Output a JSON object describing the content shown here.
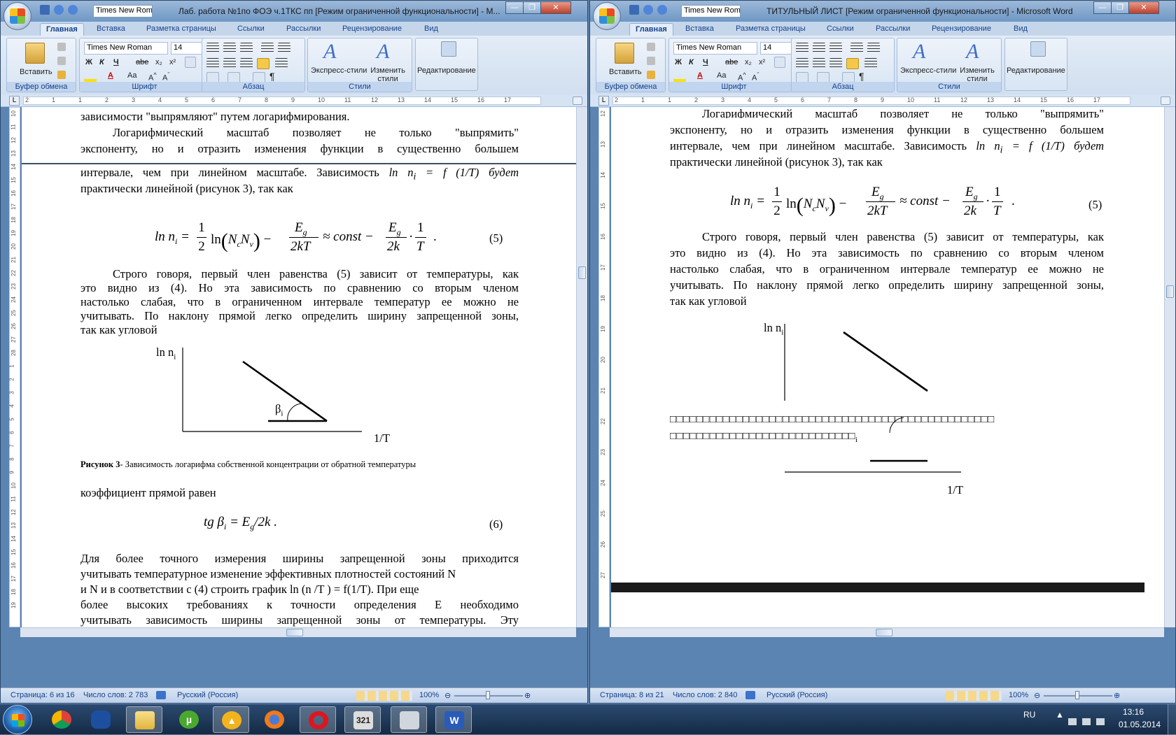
{
  "left": {
    "title": "Лаб. работа №1по ФОЭ ч.1ТКС пп [Режим ограниченной функциональности] - M...",
    "font_name": "Times New Roman",
    "font_size": "14",
    "tabs": [
      "Главная",
      "Вставка",
      "Разметка страницы",
      "Ссылки",
      "Рассылки",
      "Рецензирование",
      "Вид"
    ],
    "groups": {
      "clipboard": "Буфер обмена",
      "font": "Шрифт",
      "paragraph": "Абзац",
      "styles": "Стили"
    },
    "paste_label": "Вставить",
    "express_styles": "Экспресс-стили",
    "change_styles": "Изменить стили",
    "editing": "Редактирование",
    "ruler_numbers": [
      "2",
      "1",
      "1",
      "2",
      "3",
      "4",
      "5",
      "6",
      "7",
      "8",
      "9",
      "10",
      "11",
      "12",
      "13",
      "14",
      "15",
      "16",
      "17"
    ],
    "vruler_numbers": [
      "10",
      "11",
      "12",
      "13",
      "14",
      "15",
      "16",
      "17",
      "18",
      "19",
      "20",
      "21",
      "22",
      "23",
      "24",
      "25",
      "26",
      "27",
      "28",
      "1",
      "2",
      "3",
      "4",
      "5",
      "6",
      "7",
      "8",
      "9",
      "10",
      "11",
      "12",
      "13",
      "14",
      "15",
      "16",
      "17",
      "18",
      "19"
    ],
    "line_top1": "зависимости \"выпрямляют\" путем логарифмирования.",
    "line_top2": "Логарифмический масштаб позволяет не только \"выпрямить\"",
    "line_top3": "экспоненту, но и отразить изменения функции в существенно большем",
    "p1a": "интервале, чем при линейном масштабе. Зависимость",
    "p1a_math": "ln n",
    "p1a_sub": "i",
    "p1a_tail": " = f (1/T) будет",
    "p1b": "практически линейной (рисунок 3), так как",
    "f5_lhs": "ln n",
    "f5_sub": "i",
    "f5_half": "1",
    "f5_two": "2",
    "f5_ln": "ln",
    "f5_NcNv": "N",
    "f5_c": "c",
    "f5_Nv": "N",
    "f5_v": "v",
    "f5_E": "E",
    "f5_g": "g",
    "f5_2kT": "2kT",
    "f5_const": "≈ const −",
    "f5_2k": "2k",
    "f5_one": "1",
    "f5_T": "T",
    "f5_num": "(5)",
    "p2": [
      "Строго говоря, первый член равенства (5) зависит от температуры, как",
      "это видно из (4). Но эта зависимость по сравнению со вторым членом",
      "настолько слабая, что в ограниченном интервале температур ее можно не",
      "учитывать. По наклону прямой легко определить ширину запрещенной зоны,",
      "так как угловой"
    ],
    "fig_ylabel": "ln n",
    "fig_ysub": "i",
    "fig_beta": "β",
    "fig_betasub": "i",
    "fig_xlabel": "1/T",
    "caption_bold": "Рисунок 3",
    "caption_rest": "- Зависимость логарифма собственной концентрации от обратной температуры",
    "p3": "коэффициент прямой равен",
    "f6": "tg β",
    "f6_sub": "i",
    "f6_rest": "= E",
    "f6_g": "g",
    "f6_tail": "/2k .",
    "f6_num": "(6)",
    "p4": [
      "Для более точного измерения ширины запрещенной зоны приходится",
      "учитывать температурное изменение эффективных плотностей состояний N",
      "и N   и в соответствии с (4) строить график ln (n  /T    ) = f(1/T). При еще",
      "более высоких требованиях к точности определения E  необходимо",
      "учитывать зависимость ширины запрещенной зоны от температуры. Эту"
    ],
    "p4_sub_c": "c",
    "p4_sub_v": "v",
    "status_page": "Страница: 6 из 16",
    "status_words": "Число слов: 2 783",
    "status_lang": "Русский (Россия)",
    "zoom": "100%"
  },
  "right": {
    "title": "ТИТУЛЬНЫЙ ЛИСТ [Режим ограниченной функциональности] - Microsoft Word",
    "font_name": "Times New Roman",
    "font_size": "14",
    "tabs": [
      "Главная",
      "Вставка",
      "Разметка страницы",
      "Ссылки",
      "Рассылки",
      "Рецензирование",
      "Вид"
    ],
    "groups": {
      "clipboard": "Буфер обмена",
      "font": "Шрифт",
      "paragraph": "Абзац",
      "styles": "Стили"
    },
    "paste_label": "Вставить",
    "express_styles": "Экспресс-стили",
    "change_styles": "Изменить стили",
    "editing": "Редактирование",
    "ruler_numbers": [
      "2",
      "1",
      "1",
      "2",
      "3",
      "4",
      "5",
      "6",
      "7",
      "8",
      "9",
      "10",
      "11",
      "12",
      "13",
      "14",
      "15",
      "16",
      "17"
    ],
    "vruler_numbers": [
      "12",
      "13",
      "14",
      "15",
      "16",
      "17",
      "18",
      "19",
      "20",
      "21",
      "22",
      "23",
      "24",
      "25",
      "26",
      "27"
    ],
    "line_top1": "Логарифмический масштаб позволяет не только \"выпрямить\"",
    "p1": [
      "экспоненту, но и отразить изменения функции в существенно большем"
    ],
    "p1b_a": "интервале, чем при линейном масштабе. Зависимость",
    "p1b_math": "ln n",
    "p1b_sub": "i",
    "p1b_tail": " = f (1/T) будет",
    "p1c": "практически линейной (рисунок 3), так как",
    "f5_num": "(5)",
    "p2": [
      "Строго говоря, первый член равенства (5) зависит от температуры, как",
      "это видно из (4). Но эта зависимость по сравнению со вторым членом",
      "настолько слабая, что в ограниченном интервале температур ее можно не",
      "учитывать. По наклону прямой легко определить ширину запрещенной зоны,",
      "так как угловой"
    ],
    "fig_ylabel": "ln n",
    "fig_ysub": "i",
    "garbled1": "□□□□□□□□□□□□□□□□□□□□□□□□□□□□□□□□□□□□□□□□□□□□□□□□□",
    "garbled2": "□□□□□□□□□□□□□□□□□□□□□□□□□□□□",
    "garbled_sub": "i",
    "fig_xlabel": "1/T",
    "status_page": "Страница: 8 из 21",
    "status_words": "Число слов: 2 840",
    "status_lang": "Русский (Россия)",
    "zoom": "100%"
  },
  "taskbar": {
    "apps": [
      "chrome-icon",
      "coat-of-arms-icon",
      "folder-icon",
      "utorrent-icon",
      "aimp-icon",
      "firefox-icon",
      "opera-icon",
      "calendar-icon",
      "scanner-icon",
      "word-icon"
    ],
    "calendar_label": "321",
    "lang": "RU",
    "time": "13:16",
    "date": "01.05.2014"
  }
}
